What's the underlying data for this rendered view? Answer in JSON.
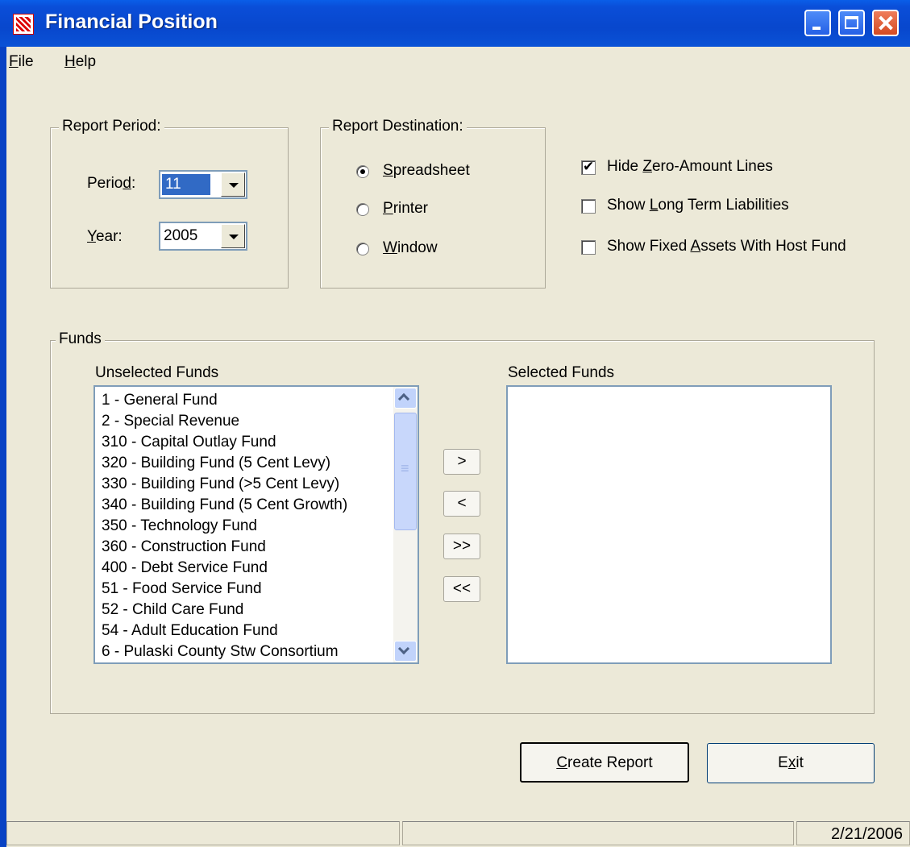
{
  "window": {
    "title": "Financial Position"
  },
  "menu": {
    "file": {
      "mnemonic": "F",
      "rest": "ile"
    },
    "help": {
      "mnemonic": "H",
      "rest": "elp"
    }
  },
  "report_period": {
    "legend": "Report Period:",
    "period": {
      "label_pre": "Perio",
      "label_mn": "d",
      "label_post": ":",
      "value": "11"
    },
    "year": {
      "label_mn": "Y",
      "label_post": "ear:",
      "value": "2005"
    }
  },
  "report_destination": {
    "legend": "Report Destination:",
    "options": [
      {
        "mn": "S",
        "rest": "preadsheet",
        "selected": true
      },
      {
        "mn": "P",
        "rest": "rinter",
        "selected": false
      },
      {
        "mn": "W",
        "rest": "indow",
        "selected": false
      }
    ]
  },
  "options": [
    {
      "pre": "Hide ",
      "mn": "Z",
      "post": "ero-Amount Lines",
      "checked": true
    },
    {
      "pre": "Show ",
      "mn": "L",
      "post": "ong Term Liabilities",
      "checked": false
    },
    {
      "pre": "Show Fixed ",
      "mn": "A",
      "post": "ssets With Host Fund",
      "checked": false
    }
  ],
  "funds": {
    "legend": "Funds",
    "unselected_label": "Unselected Funds",
    "selected_label": "Selected Funds",
    "unselected": [
      "1 - General Fund",
      "2 - Special Revenue",
      "310 - Capital Outlay Fund",
      "320 - Building Fund (5 Cent Levy)",
      "330 - Building Fund (>5 Cent Levy)",
      "340 - Building Fund (5 Cent Growth)",
      "350 - Technology Fund",
      "360 - Construction Fund",
      "400 - Debt Service Fund",
      "51 - Food Service Fund",
      "52 - Child Care Fund",
      "54 - Adult Education Fund",
      "6 - Pulaski County Stw Consortium"
    ],
    "selected": [],
    "move_buttons": {
      "add": ">",
      "remove": "<",
      "add_all": ">>",
      "remove_all": "<<"
    }
  },
  "buttons": {
    "create": {
      "mn": "C",
      "rest": "reate Report"
    },
    "exit": {
      "pre": "E",
      "mn": "x",
      "post": "it"
    }
  },
  "status": {
    "date": "2/21/2006"
  }
}
